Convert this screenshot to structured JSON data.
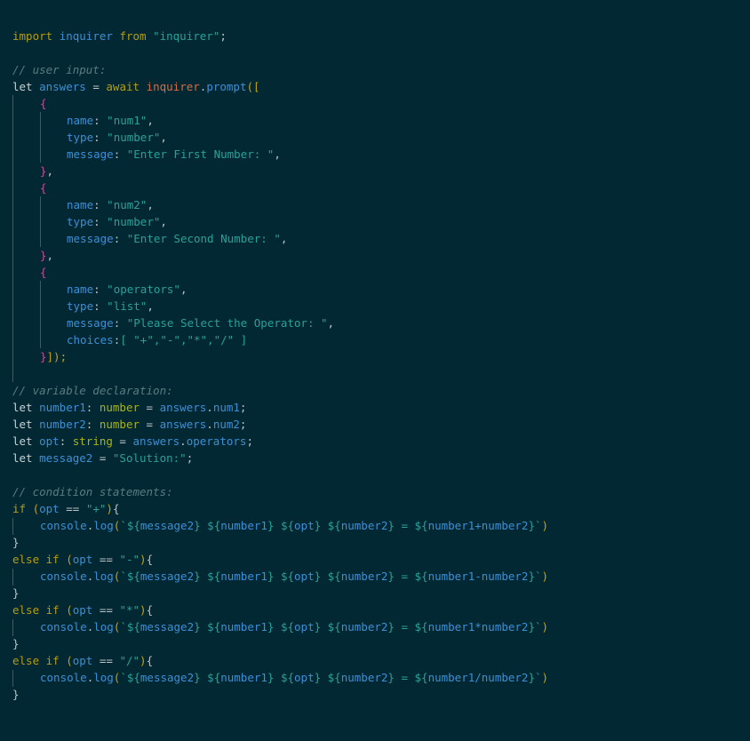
{
  "code": {
    "import": {
      "kw": "import",
      "name": "inquirer",
      "from": "from",
      "module": "\"inquirer\"",
      "end": ";"
    },
    "c1": "// user input:",
    "prompt": {
      "let": "let",
      "name": "answers",
      "eq": "=",
      "await": "await",
      "obj": "inquirer",
      "dot": ".",
      "fn": "prompt",
      "open": "([",
      "close": "]);"
    },
    "q1": {
      "name_k": "name",
      "name_v": "\"num1\"",
      "type_k": "type",
      "type_v": "\"number\"",
      "msg_k": "message",
      "msg_v": "\"Enter First Number: \""
    },
    "q2": {
      "name_k": "name",
      "name_v": "\"num2\"",
      "type_k": "type",
      "type_v": "\"number\"",
      "msg_k": "message",
      "msg_v": "\"Enter Second Number: \""
    },
    "q3": {
      "name_k": "name",
      "name_v": "\"operators\"",
      "type_k": "type",
      "type_v": "\"list\"",
      "msg_k": "message",
      "msg_v": "\"Please Select the Operator: \"",
      "choices_k": "choices",
      "choices_v": "[ \"+\",\"-\",\"*\",\"/\" ]"
    },
    "c2": "// variable declaration:",
    "decl1": {
      "let": "let",
      "name": "number1",
      "type": "number",
      "rhs_obj": "answers",
      "rhs_prop": "num1"
    },
    "decl2": {
      "let": "let",
      "name": "number2",
      "type": "number",
      "rhs_obj": "answers",
      "rhs_prop": "num2"
    },
    "decl3": {
      "let": "let",
      "name": "opt",
      "type": "string",
      "rhs_obj": "answers",
      "rhs_prop": "operators"
    },
    "decl4": {
      "let": "let",
      "name": "message2",
      "value": "\"Solution:\""
    },
    "c3": "// condition statements:",
    "if1": {
      "kw": "if",
      "var": "opt",
      "op": "==",
      "val": "\"+\"",
      "expr": "number1+number2"
    },
    "if2": {
      "kw": "else if",
      "var": "opt",
      "op": "==",
      "val": "\"-\"",
      "expr": "number1-number2"
    },
    "if3": {
      "kw": "else if",
      "var": "opt",
      "op": "==",
      "val": "\"*\"",
      "expr": "number1*number2"
    },
    "if4": {
      "kw": "else if",
      "var": "opt",
      "op": "==",
      "val": "\"/\"",
      "expr": "number1/number2"
    },
    "log": {
      "obj": "console",
      "fn": "log",
      "m": "message2",
      "n1": "number1",
      "o": "opt",
      "n2": "number2"
    }
  }
}
